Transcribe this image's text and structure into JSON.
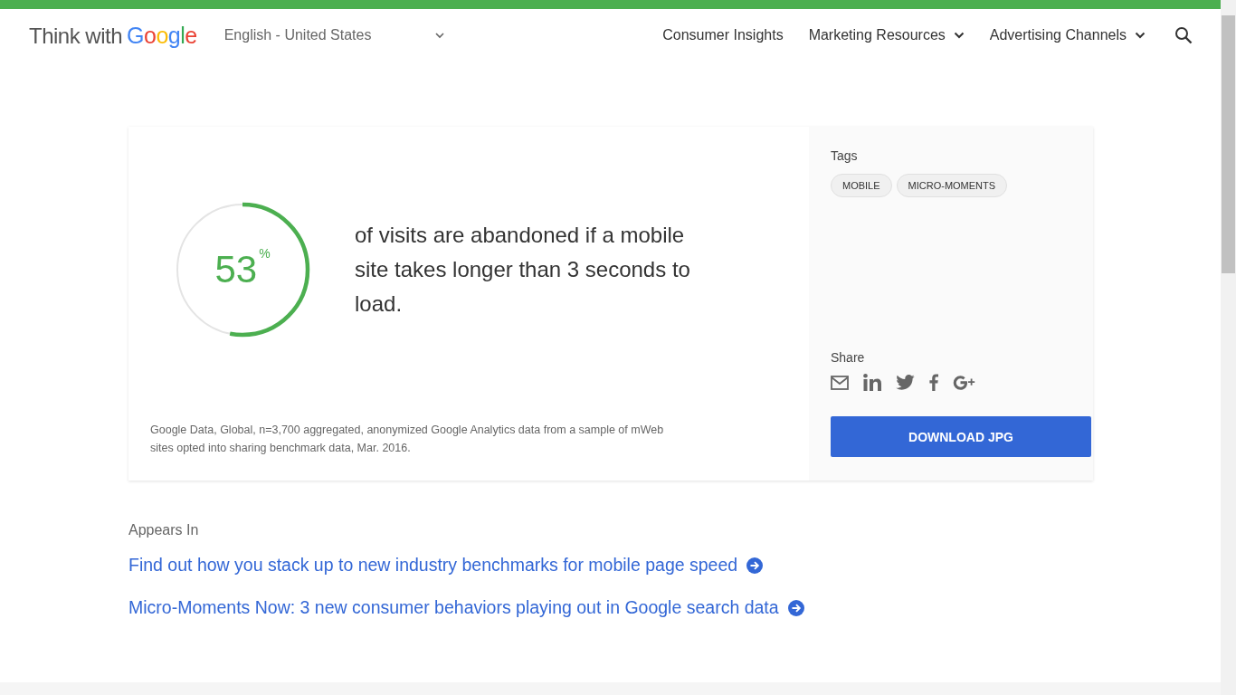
{
  "header": {
    "logo": {
      "prefix": "Think with",
      "brand": "Google"
    },
    "language": {
      "value": "English - United States"
    },
    "nav": [
      {
        "label": "Consumer Insights",
        "dropdown": false
      },
      {
        "label": "Marketing Resources",
        "dropdown": true
      },
      {
        "label": "Advertising Channels",
        "dropdown": true
      }
    ]
  },
  "stat_card": {
    "stat": {
      "value": "53",
      "unit": "%",
      "level": 0.53
    },
    "statement": "of visits are abandoned if a mobile site takes longer than 3 seconds to load.",
    "source": "Google Data, Global, n=3,700 aggregated, anonymized Google Analytics data from a sample of mWeb sites opted into sharing benchmark data, Mar. 2016.",
    "tags_label": "Tags",
    "tags": [
      "MOBILE",
      "MICRO-MOMENTS"
    ],
    "share_label": "Share",
    "share": [
      {
        "kind": "email"
      },
      {
        "kind": "linkedin"
      },
      {
        "kind": "twitter"
      },
      {
        "kind": "facebook"
      },
      {
        "kind": "googleplus"
      }
    ],
    "download_button": "DOWNLOAD JPG"
  },
  "appears_in": {
    "heading": "Appears In",
    "links": [
      "Find out how you stack up to new industry benchmarks for mobile page speed",
      "Micro-Moments Now: 3 new consumer behaviors playing out in Google search data"
    ]
  }
}
